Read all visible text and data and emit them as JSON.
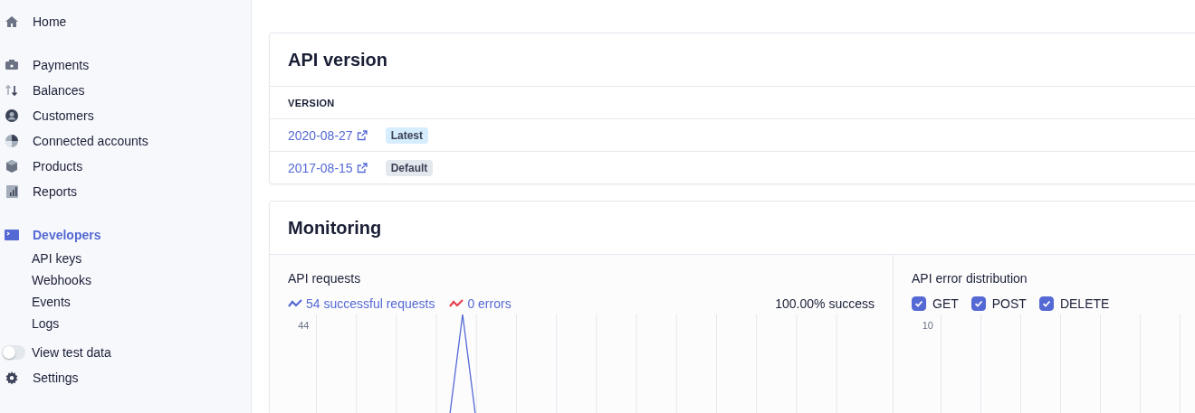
{
  "sidebar": {
    "sections": [
      {
        "items": [
          {
            "kind": "link",
            "label": "Home",
            "selected": false
          }
        ]
      },
      {
        "items": [
          {
            "kind": "link",
            "label": "Payments",
            "selected": false
          },
          {
            "kind": "link",
            "label": "Balances",
            "selected": false
          },
          {
            "kind": "link",
            "label": "Customers",
            "selected": false
          },
          {
            "kind": "link",
            "label": "Connected accounts",
            "selected": false
          },
          {
            "kind": "link",
            "label": "Products",
            "selected": false
          },
          {
            "kind": "link",
            "label": "Reports",
            "selected": false
          }
        ]
      },
      {
        "items": [
          {
            "kind": "link",
            "label": "Developers",
            "selected": true,
            "children": [
              {
                "label": "API keys"
              },
              {
                "label": "Webhooks"
              },
              {
                "label": "Events"
              },
              {
                "label": "Logs"
              }
            ]
          },
          {
            "kind": "toggle",
            "label": "View test data",
            "on": false
          },
          {
            "kind": "link",
            "label": "Settings",
            "selected": false
          }
        ]
      }
    ]
  },
  "api_version": {
    "title": "API version",
    "column": "VERSION",
    "rows": [
      {
        "version": "2020-08-27",
        "badge": "Latest",
        "color": "#d6ecff"
      },
      {
        "version": "2017-08-15",
        "badge": "Default",
        "color": "#e3e8ee"
      }
    ]
  },
  "monitoring": {
    "title": "Monitoring",
    "requests": {
      "title": "API requests",
      "legend": [
        {
          "label": "54 successful requests",
          "color": "#5469d4"
        },
        {
          "label": "0 errors",
          "color": "#e5424d"
        }
      ],
      "success": "100.00% success",
      "y_tick": "44"
    },
    "errors": {
      "title": "API error distribution",
      "filters": [
        {
          "label": "GET",
          "checked": true
        },
        {
          "label": "POST",
          "checked": true
        },
        {
          "label": "DELETE",
          "checked": true
        }
      ],
      "y_tick": "10"
    }
  }
}
